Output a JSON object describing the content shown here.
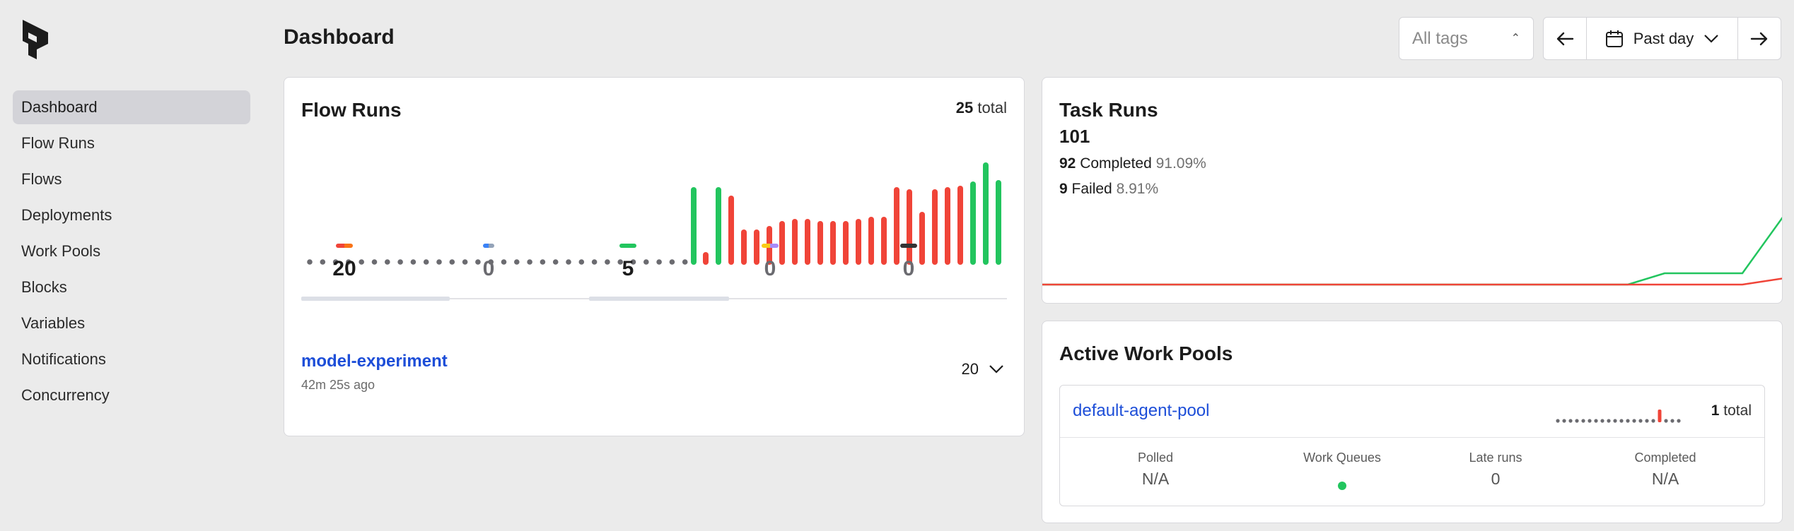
{
  "sidebar": {
    "items": [
      {
        "label": "Dashboard",
        "active": true
      },
      {
        "label": "Flow Runs"
      },
      {
        "label": "Flows"
      },
      {
        "label": "Deployments"
      },
      {
        "label": "Work Pools"
      },
      {
        "label": "Blocks"
      },
      {
        "label": "Variables"
      },
      {
        "label": "Notifications"
      },
      {
        "label": "Concurrency"
      }
    ]
  },
  "header": {
    "title": "Dashboard",
    "tags_placeholder": "All tags",
    "date_range": "Past day"
  },
  "flow_runs": {
    "title": "Flow Runs",
    "total_count": "25",
    "total_label": "total",
    "stats": [
      {
        "value": "20",
        "colors": [
          "#f04438",
          "#f97316"
        ]
      },
      {
        "value": "0",
        "colors": [
          "#3b82f6",
          "#94a3b8"
        ]
      },
      {
        "value": "5",
        "colors": [
          "#22c55e"
        ]
      },
      {
        "value": "0",
        "colors": [
          "#facc15",
          "#a78bfa"
        ]
      },
      {
        "value": "0",
        "colors": [
          "#333333"
        ]
      }
    ],
    "flow_name": "model-experiment",
    "flow_time": "42m 25s ago",
    "flow_count": "20"
  },
  "task_runs": {
    "title": "Task Runs",
    "total": "101",
    "completed_count": "92",
    "completed_label": "Completed",
    "completed_pct": "91.09%",
    "failed_count": "9",
    "failed_label": "Failed",
    "failed_pct": "8.91%"
  },
  "work_pools": {
    "title": "Active Work Pools",
    "pool_name": "default-agent-pool",
    "pool_total": "1",
    "pool_total_label": "total",
    "stats": [
      {
        "label": "Polled",
        "value": "N/A"
      },
      {
        "label": "Work Queues",
        "value": ""
      },
      {
        "label": "Late runs",
        "value": "0"
      },
      {
        "label": "Completed",
        "value": "N/A"
      }
    ]
  },
  "colors": {
    "completed": "#22c55e",
    "failed": "#f04438",
    "link": "#1d4ed8",
    "idle_dot": "#6b6b70"
  }
}
